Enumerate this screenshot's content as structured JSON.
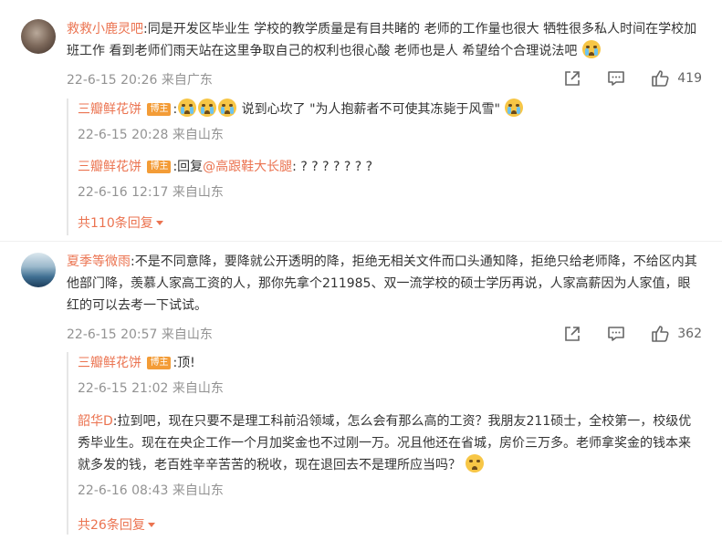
{
  "comments": [
    {
      "username": "救救小鹿灵吧",
      "text": ":同是开发区毕业生 学校的教学质量是有目共睹的 老师的工作量也很大 牺牲很多私人时间在学校加班工作 看到老师们雨天站在这里争取自己的权利也很心酸 老师也是人 希望给个合理说法吧",
      "emoji": "流泪",
      "meta": "22-6-15 20:26 来自广东",
      "like_count": "419",
      "replies": [
        {
          "username": "三瓣鲜花饼",
          "badge": "博主",
          "text": " 说到心坎了 \"为人抱薪者不可使其冻毙于风雪\"",
          "meta": "22-6-15 20:28 来自山东"
        },
        {
          "username": "三瓣鲜花饼",
          "badge": "博主",
          "reply_prefix": ":回复",
          "mention": "@高跟鞋大长腿",
          "text": ": ? ? ? ? ? ? ?",
          "meta": "22-6-16 12:17 来自山东"
        }
      ],
      "more_replies": "共110条回复"
    },
    {
      "username": "夏季等微雨",
      "text": ":不是不同意降，要降就公开透明的降，拒绝无相关文件而口头通知降，拒绝只给老师降，不给区内其他部门降，羡慕人家高工资的人，那你先拿个211985、双一流学校的硕士学历再说，人家高薪因为人家值，眼红的可以去考一下试试。",
      "meta": "22-6-15 20:57 来自山东",
      "like_count": "362",
      "replies": [
        {
          "username": "三瓣鲜花饼",
          "badge": "博主",
          "text": ":顶!",
          "meta": "22-6-15 21:02 来自山东"
        },
        {
          "username": "韶华D",
          "text": ":拉到吧，现在只要不是理工科前沿领域，怎么会有那么高的工资？我朋友211硕士，全校第一，校级优秀毕业生。现在在央企工作一个月加奖金也不过刚一万。况且他还在省城，房价三万多。老师拿奖金的钱本来就多发的钱，老百姓辛辛苦苦的税收，现在退回去不是理所应当吗？",
          "meta": "22-6-16 08:43 来自山东"
        }
      ],
      "more_replies": "共26条回复"
    }
  ],
  "icons": {
    "share": "share-icon",
    "comment": "comment-icon",
    "like": "like-icon"
  }
}
